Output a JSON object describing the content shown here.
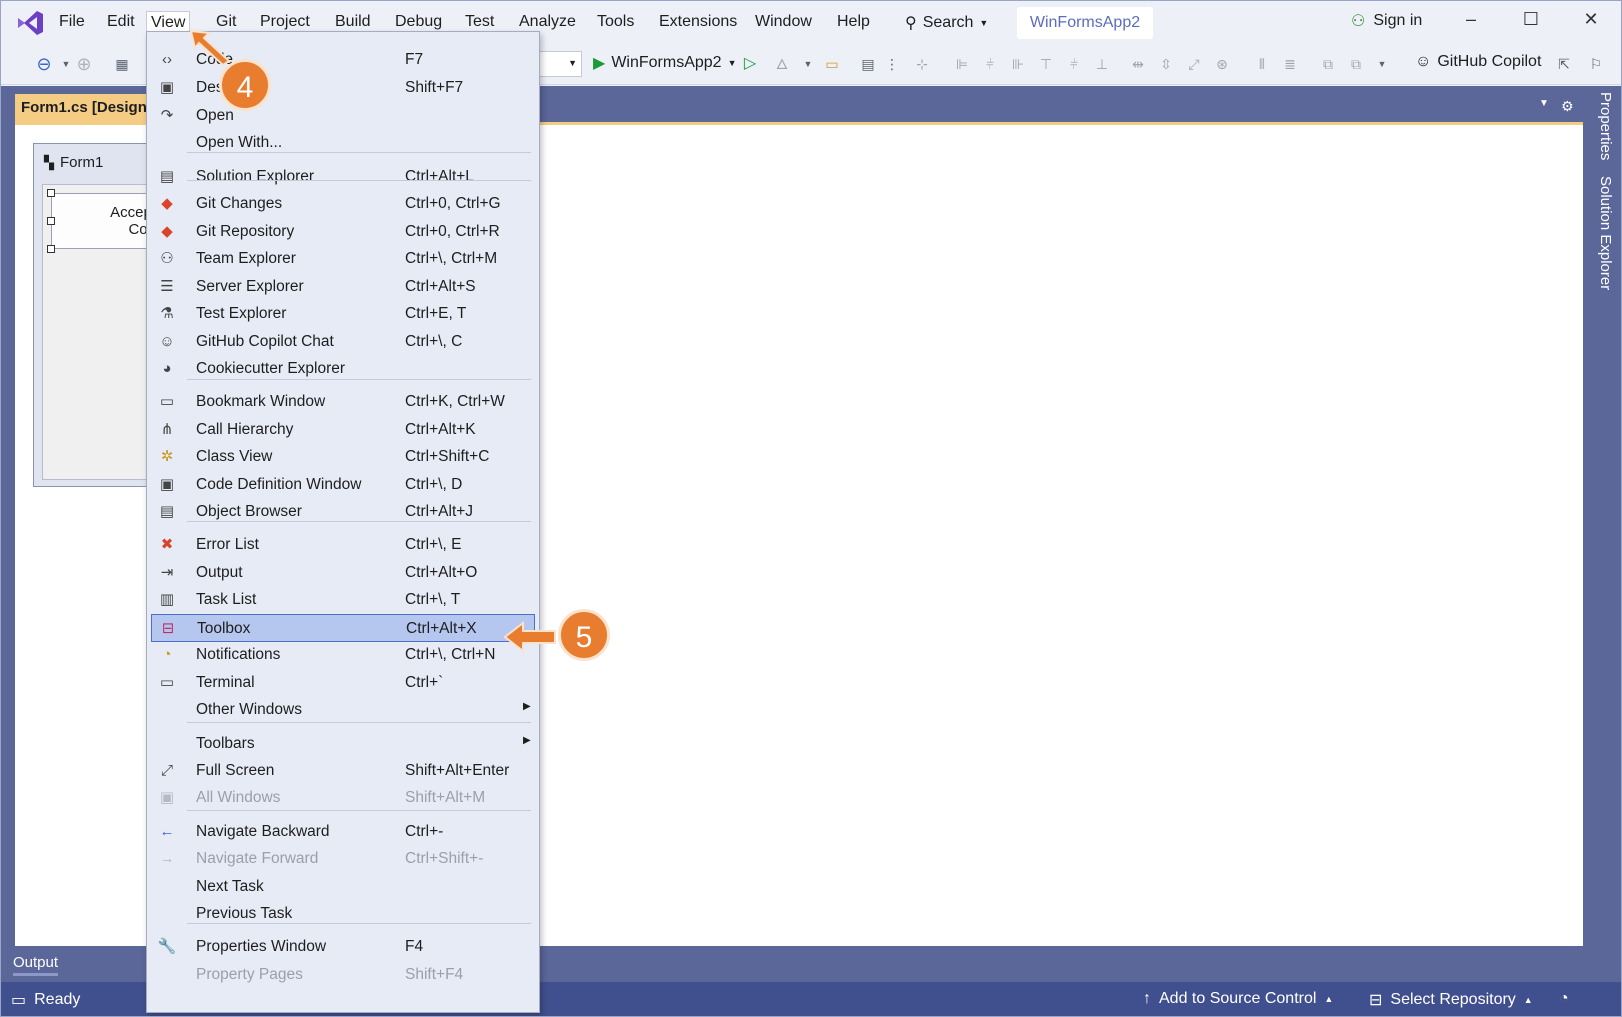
{
  "menubar": {
    "items": [
      "File",
      "Edit",
      "View",
      "Git",
      "Project",
      "Build",
      "Debug",
      "Test",
      "Analyze",
      "Tools",
      "Extensions",
      "Window",
      "Help"
    ],
    "search_label": "Search",
    "solution_name": "WinFormsApp2",
    "signin_label": "Sign in"
  },
  "toolbar": {
    "run_target": "WinFormsApp2",
    "copilot_label": "GitHub Copilot"
  },
  "document": {
    "tab_title": "Form1.cs [Design]",
    "form_title": "Form1",
    "button_text_line1": "Accept",
    "button_text_line2": "Con"
  },
  "right_tabs": [
    "Properties",
    "Solution Explorer"
  ],
  "view_menu": {
    "items": [
      {
        "icon": "code-icon",
        "glyph": "‹›",
        "label": "Code",
        "shortcut": "F7"
      },
      {
        "icon": "designer-icon",
        "glyph": "▣",
        "label": "Designer",
        "shortcut": "Shift+F7"
      },
      {
        "icon": "open-icon",
        "glyph": "↷",
        "label": "Open",
        "shortcut": ""
      },
      {
        "icon": "",
        "glyph": "",
        "label": "Open With...",
        "shortcut": ""
      },
      {
        "icon": "solution-explorer-icon",
        "glyph": "▤",
        "label": "Solution Explorer",
        "shortcut": "Ctrl+Alt+L"
      },
      {
        "icon": "git-changes-icon",
        "glyph": "◆",
        "label": "Git Changes",
        "shortcut": "Ctrl+0, Ctrl+G"
      },
      {
        "icon": "git-repository-icon",
        "glyph": "◆",
        "label": "Git Repository",
        "shortcut": "Ctrl+0, Ctrl+R"
      },
      {
        "icon": "team-explorer-icon",
        "glyph": "⚇",
        "label": "Team Explorer",
        "shortcut": "Ctrl+\\, Ctrl+M"
      },
      {
        "icon": "server-explorer-icon",
        "glyph": "☰",
        "label": "Server Explorer",
        "shortcut": "Ctrl+Alt+S"
      },
      {
        "icon": "test-explorer-icon",
        "glyph": "⚗",
        "label": "Test Explorer",
        "shortcut": "Ctrl+E, T"
      },
      {
        "icon": "copilot-chat-icon",
        "glyph": "☺",
        "label": "GitHub Copilot Chat",
        "shortcut": "Ctrl+\\, C"
      },
      {
        "icon": "cookiecutter-icon",
        "glyph": "◕",
        "label": "Cookiecutter Explorer",
        "shortcut": ""
      },
      {
        "icon": "bookmark-icon",
        "glyph": "▭",
        "label": "Bookmark Window",
        "shortcut": "Ctrl+K, Ctrl+W"
      },
      {
        "icon": "call-hierarchy-icon",
        "glyph": "⋔",
        "label": "Call Hierarchy",
        "shortcut": "Ctrl+Alt+K"
      },
      {
        "icon": "class-view-icon",
        "glyph": "✲",
        "label": "Class View",
        "shortcut": "Ctrl+Shift+C"
      },
      {
        "icon": "code-definition-icon",
        "glyph": "▣",
        "label": "Code Definition Window",
        "shortcut": "Ctrl+\\, D"
      },
      {
        "icon": "object-browser-icon",
        "glyph": "▤",
        "label": "Object Browser",
        "shortcut": "Ctrl+Alt+J"
      },
      {
        "icon": "error-list-icon",
        "glyph": "✖",
        "label": "Error List",
        "shortcut": "Ctrl+\\, E"
      },
      {
        "icon": "output-icon",
        "glyph": "⇥",
        "label": "Output",
        "shortcut": "Ctrl+Alt+O"
      },
      {
        "icon": "task-list-icon",
        "glyph": "▥",
        "label": "Task List",
        "shortcut": "Ctrl+\\, T"
      },
      {
        "icon": "toolbox-icon",
        "glyph": "⊟",
        "label": "Toolbox",
        "shortcut": "Ctrl+Alt+X"
      },
      {
        "icon": "notifications-icon",
        "glyph": "◔",
        "label": "Notifications",
        "shortcut": "Ctrl+\\, Ctrl+N"
      },
      {
        "icon": "terminal-icon",
        "glyph": "▭",
        "label": "Terminal",
        "shortcut": "Ctrl+`"
      },
      {
        "icon": "",
        "glyph": "",
        "label": "Other Windows",
        "shortcut": ""
      },
      {
        "icon": "",
        "glyph": "",
        "label": "Toolbars",
        "shortcut": ""
      },
      {
        "icon": "full-screen-icon",
        "glyph": "⤢",
        "label": "Full Screen",
        "shortcut": "Shift+Alt+Enter"
      },
      {
        "icon": "all-windows-icon",
        "glyph": "▣",
        "label": "All Windows",
        "shortcut": "Shift+Alt+M"
      },
      {
        "icon": "navigate-backward-icon",
        "glyph": "←",
        "label": "Navigate Backward",
        "shortcut": "Ctrl+-"
      },
      {
        "icon": "navigate-forward-icon",
        "glyph": "→",
        "label": "Navigate Forward",
        "shortcut": "Ctrl+Shift+-"
      },
      {
        "icon": "",
        "glyph": "",
        "label": "Next Task",
        "shortcut": ""
      },
      {
        "icon": "",
        "glyph": "",
        "label": "Previous Task",
        "shortcut": ""
      },
      {
        "icon": "properties-window-icon",
        "glyph": "🔧",
        "label": "Properties Window",
        "shortcut": "F4"
      },
      {
        "icon": "",
        "glyph": "",
        "label": "Property Pages",
        "shortcut": "Shift+F4"
      }
    ]
  },
  "callouts": {
    "step4": "4",
    "step5": "5"
  },
  "output_tab": {
    "label": "Output"
  },
  "statusbar": {
    "ready": "Ready",
    "add_source_control": "Add to Source Control",
    "select_repository": "Select Repository"
  },
  "colors": {
    "accent": "#e87d30",
    "status_bar": "#40508f",
    "highlight": "#b5c6ef"
  }
}
